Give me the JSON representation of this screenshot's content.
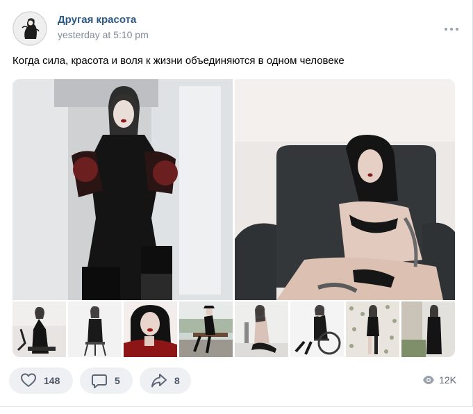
{
  "post": {
    "author": "Другая красота",
    "time": "yesterday at 5:10 pm",
    "text": "Когда сила, красота и воля к жизни объединяются в одном человеке"
  },
  "photos": {
    "main": [
      {
        "icon": "photo-woman-black-corset"
      },
      {
        "icon": "photo-woman-on-armchair"
      }
    ],
    "thumbnails": [
      {
        "icon": "photo-woman-seated-black-dress"
      },
      {
        "icon": "photo-woman-on-stool"
      },
      {
        "icon": "photo-woman-red-sweater"
      },
      {
        "icon": "photo-woman-on-bench-outdoors"
      },
      {
        "icon": "photo-woman-sitting-on-floor"
      },
      {
        "icon": "photo-woman-in-wheelchair"
      },
      {
        "icon": "photo-woman-standing-patterned-wall"
      },
      {
        "icon": "photo-woman-black-coat"
      }
    ]
  },
  "actions": {
    "likes": "148",
    "comments": "5",
    "shares": "8",
    "views": "12K"
  },
  "colors": {
    "author_link": "#2a5885",
    "meta_gray": "#818c99",
    "button_bg": "#eef0f3",
    "icon_gray": "#5b6573"
  }
}
